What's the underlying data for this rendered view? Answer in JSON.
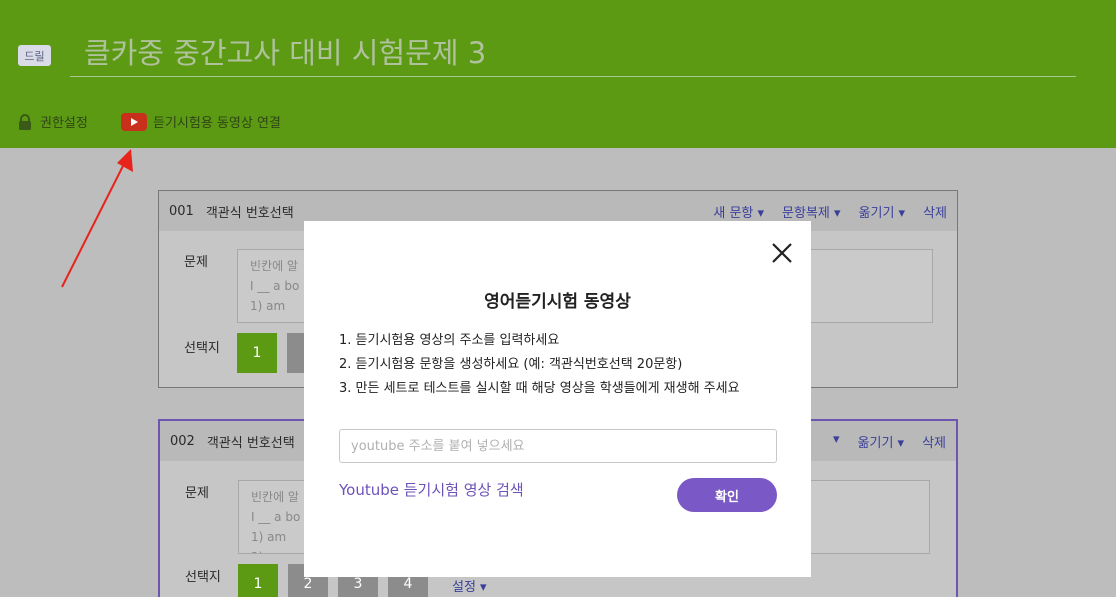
{
  "header": {
    "badge": "드릴",
    "title": "클카중 중간고사 대비 시험문제 3",
    "permission_label": "권한설정",
    "video_link_label": "듣기시험용 동영상 연결"
  },
  "cards": [
    {
      "number": "001",
      "type": "객관식 번호선택",
      "actions": [
        "새 문항 ▾",
        "문항복제 ▾",
        "옮기기 ▾",
        "삭제"
      ],
      "question_label": "문제",
      "question_text": "빈칸에 알\nI __ a bo\n1) am",
      "choices_label": "선택지",
      "choices": [
        "1"
      ]
    },
    {
      "number": "002",
      "type": "객관식 번호선택",
      "actions": [
        "▾",
        "옮기기 ▾",
        "삭제"
      ],
      "question_label": "문제",
      "question_text": "빈칸에 알\nI __ a bo\n1) am\n2)",
      "choices_label": "선택지",
      "choices": [
        "1",
        "2",
        "3",
        "4"
      ],
      "setting_label": "설정 ▾"
    }
  ],
  "modal": {
    "title": "영어듣기시험 동영상",
    "steps": [
      "1. 듣기시험용 영상의 주소를 입력하세요",
      "2. 듣기시험용 문항을 생성하세요 (예: 객관식번호선택 20문항)",
      "3. 만든 세트로 테스트를 실시할 때 해당 영상을 학생들에게 재생해 주세요"
    ],
    "input_placeholder": "youtube 주소를 붙여 넣으세요",
    "search_link": "Youtube 듣기시험 영상 검색",
    "confirm_label": "확인"
  },
  "colors": {
    "header_green": "#5c9a14",
    "accent_purple": "#7a58c5",
    "youtube_red": "#c9301c",
    "annotation_red": "#e8231b"
  }
}
